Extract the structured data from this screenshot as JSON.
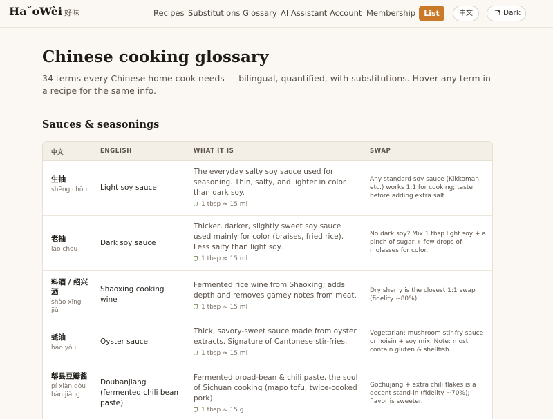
{
  "header": {
    "logo_text": "HaˇoWèi",
    "logo_cn": "好味",
    "nav": [
      "Recipes",
      "Substitutions",
      "Glossary",
      "AI Assistant",
      "Account",
      "Membership"
    ],
    "list_label": "List",
    "lang_label": "中文",
    "dark_label": "Dark"
  },
  "page": {
    "title": "Chinese cooking glossary",
    "subtitle": "34 terms every Chinese home cook needs — bilingual, quantified, with substitutions. Hover any term in a recipe for the same info.",
    "section_title": "Sauces & seasonings"
  },
  "table": {
    "headers": [
      "中文",
      "ENGLISH",
      "WHAT IT IS",
      "SWAP"
    ],
    "rows": [
      {
        "zh": "生抽",
        "pinyin": "shēng chōu",
        "english": "Light soy sauce",
        "what": "The everyday salty soy sauce used for seasoning. Thin, salty, and lighter in color than dark soy.",
        "qty": "1 tbsp ≈ 15 ml",
        "swap": "Any standard soy sauce (Kikkoman etc.) works 1:1 for cooking; taste before adding extra salt."
      },
      {
        "zh": "老抽",
        "pinyin": "lǎo chōu",
        "english": "Dark soy sauce",
        "what": "Thicker, darker, slightly sweet soy sauce used mainly for color (braises, fried rice). Less salty than light soy.",
        "qty": "1 tbsp ≈ 15 ml",
        "swap": "No dark soy? Mix 1 tbsp light soy + a pinch of sugar + few drops of molasses for color."
      },
      {
        "zh": "料酒 / 绍兴酒",
        "pinyin": "shào xīng jiǔ",
        "english": "Shaoxing cooking wine",
        "what": "Fermented rice wine from Shaoxing; adds depth and removes gamey notes from meat.",
        "qty": "1 tbsp ≈ 15 ml",
        "swap": "Dry sherry is the closest 1:1 swap (fidelity ~80%)."
      },
      {
        "zh": "蚝油",
        "pinyin": "háo yóu",
        "english": "Oyster sauce",
        "what": "Thick, savory-sweet sauce made from oyster extracts. Signature of Cantonese stir-fries.",
        "qty": "1 tbsp ≈ 15 ml",
        "swap": "Vegetarian: mushroom stir-fry sauce or hoisin + soy mix. Note: most contain gluten & shellfish."
      },
      {
        "zh": "郫县豆瓣酱",
        "pinyin": "pí xiàn dòu bàn jiàng",
        "english": "Doubanjiang (fermented chili bean paste)",
        "what": "Fermented broad-bean & chili paste, the soul of Sichuan cooking (mapo tofu, twice-cooked pork).",
        "qty": "1 tbsp ≈ 15 g",
        "swap": "Gochujang + extra chili flakes is a decent stand-in (fidelity ~70%); flavor is sweeter."
      }
    ]
  }
}
